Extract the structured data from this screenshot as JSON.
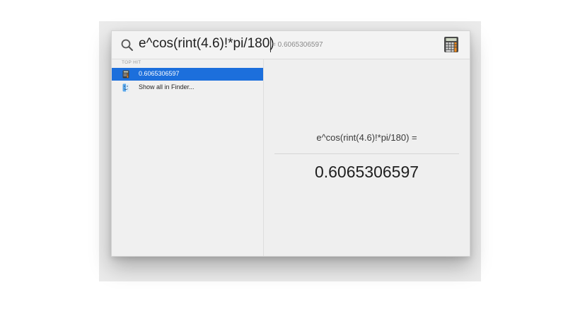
{
  "search": {
    "query": "e^cos(rint(4.6)!*pi/180)",
    "inline_result": "= 0.6065306597"
  },
  "results": {
    "section_label": "TOP HIT",
    "items": [
      {
        "label": "0.6065306597",
        "icon": "calculator-icon",
        "selected": true
      },
      {
        "label": "Show all in Finder...",
        "icon": "finder-icon",
        "selected": false
      }
    ]
  },
  "preview": {
    "expression": "e^cos(rint(4.6)!*pi/180) =",
    "result": "0.6065306597"
  },
  "colors": {
    "selection": "#1c6fdc",
    "text": "#1f1f1f",
    "muted": "#8a8a8a"
  }
}
